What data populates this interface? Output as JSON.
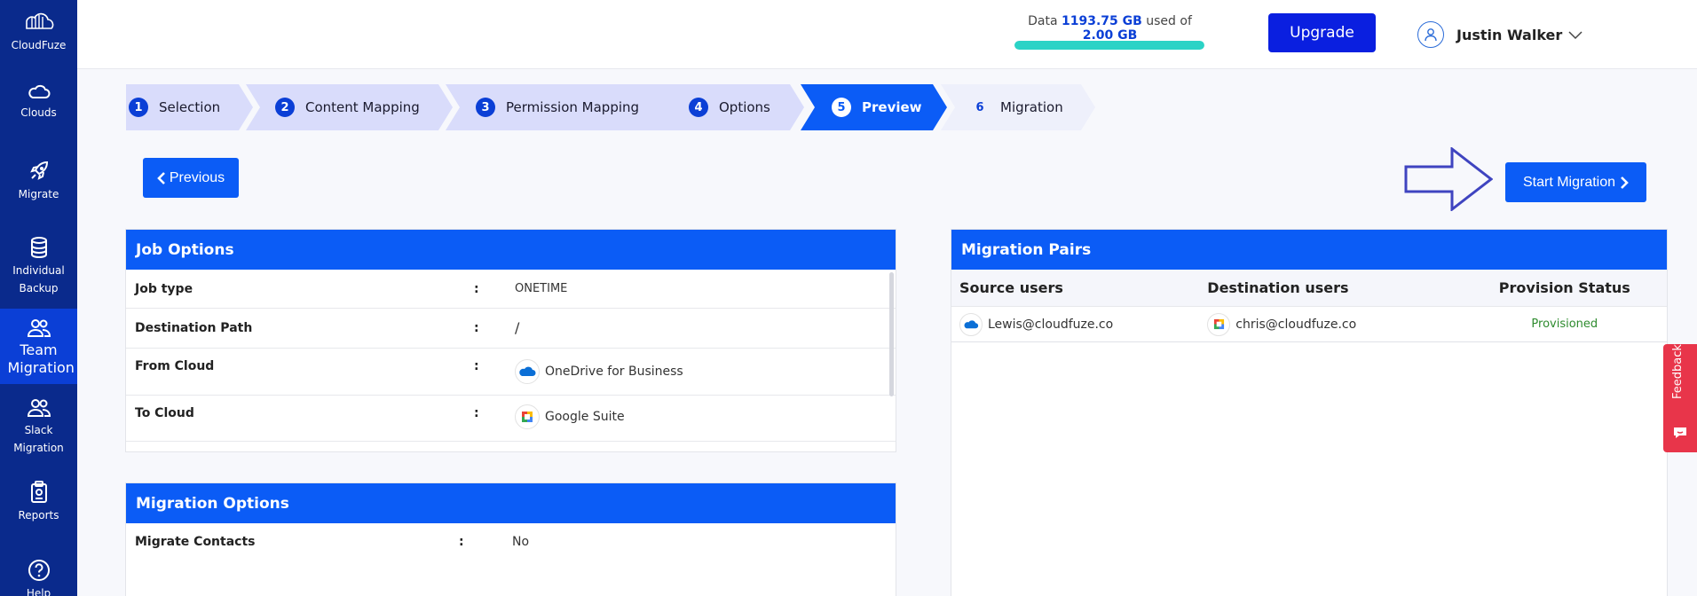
{
  "sidebar": {
    "brand": "CloudFuze",
    "items": [
      {
        "label": "Clouds",
        "icon": "cloud-icon"
      },
      {
        "label": "Migrate",
        "icon": "rocket-icon"
      },
      {
        "label": "Individual Backup",
        "icon": "database-icon"
      },
      {
        "label": "Team Migration",
        "icon": "users-icon"
      },
      {
        "label": "Slack Migration",
        "icon": "users-icon"
      },
      {
        "label": "Reports",
        "icon": "clipboard-icon"
      },
      {
        "label": "Help",
        "icon": "help-icon"
      }
    ]
  },
  "header": {
    "usage_prefix": "Data",
    "usage_used": "1193.75 GB",
    "usage_mid": "used of",
    "usage_total": "2.00 GB",
    "usage_fraction": 1.0,
    "upgrade_label": "Upgrade",
    "user_name": "Justin Walker"
  },
  "steps": [
    {
      "num": "1",
      "label": "Selection",
      "state": "done"
    },
    {
      "num": "2",
      "label": "Content Mapping",
      "state": "done"
    },
    {
      "num": "3",
      "label": "Permission Mapping",
      "state": "done"
    },
    {
      "num": "4",
      "label": "Options",
      "state": "done"
    },
    {
      "num": "5",
      "label": "Preview",
      "state": "active"
    },
    {
      "num": "6",
      "label": "Migration",
      "state": "pending"
    }
  ],
  "actions": {
    "previous_label": "Previous",
    "start_label": "Start Migration"
  },
  "job_options": {
    "title": "Job Options",
    "rows": [
      {
        "key": "Job type",
        "sep": ":",
        "value": "ONETIME"
      },
      {
        "key": "Destination Path",
        "sep": ":",
        "value": "/"
      },
      {
        "key": "From Cloud",
        "sep": ":",
        "value": "OneDrive for Business"
      },
      {
        "key": "To Cloud",
        "sep": ":",
        "value": "Google Suite"
      }
    ]
  },
  "migration_options": {
    "title": "Migration Options",
    "rows": [
      {
        "key": "Migrate Contacts",
        "sep": ":",
        "value": "No"
      }
    ]
  },
  "pairs": {
    "title": "Migration Pairs",
    "columns": [
      "Source users",
      "Destination users",
      "Provision Status"
    ],
    "rows": [
      {
        "source": "Lewis@cloudfuze.co",
        "destination": "chris@cloudfuze.co",
        "status": "Provisioned"
      }
    ]
  },
  "feedback_label": "Feedback",
  "colors": {
    "sidebar": "#0a2a8c",
    "primary": "#0b5cf6",
    "step_done": "#d9dcfb",
    "status_ok": "#2e8b2e",
    "feedback": "#e8354a"
  }
}
